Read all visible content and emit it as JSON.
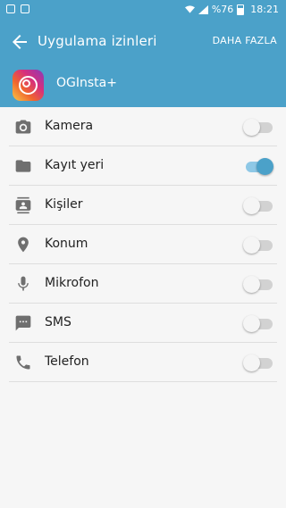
{
  "status_bar": {
    "battery": "%76",
    "time": "18:21"
  },
  "app_bar": {
    "title": "Uygulama izinleri",
    "more": "DAHA FAZLA"
  },
  "app": {
    "name": "OGInsta+"
  },
  "permissions": [
    {
      "label": "Kamera",
      "icon": "camera-icon",
      "enabled": false
    },
    {
      "label": "Kayıt yeri",
      "icon": "folder-icon",
      "enabled": true
    },
    {
      "label": "Kişiler",
      "icon": "contacts-icon",
      "enabled": false
    },
    {
      "label": "Konum",
      "icon": "location-pin-icon",
      "enabled": false
    },
    {
      "label": "Mikrofon",
      "icon": "microphone-icon",
      "enabled": false
    },
    {
      "label": "SMS",
      "icon": "sms-icon",
      "enabled": false
    },
    {
      "label": "Telefon",
      "icon": "phone-icon",
      "enabled": false
    }
  ],
  "colors": {
    "accent": "#4ba1c9",
    "background": "#f6f6f6"
  }
}
